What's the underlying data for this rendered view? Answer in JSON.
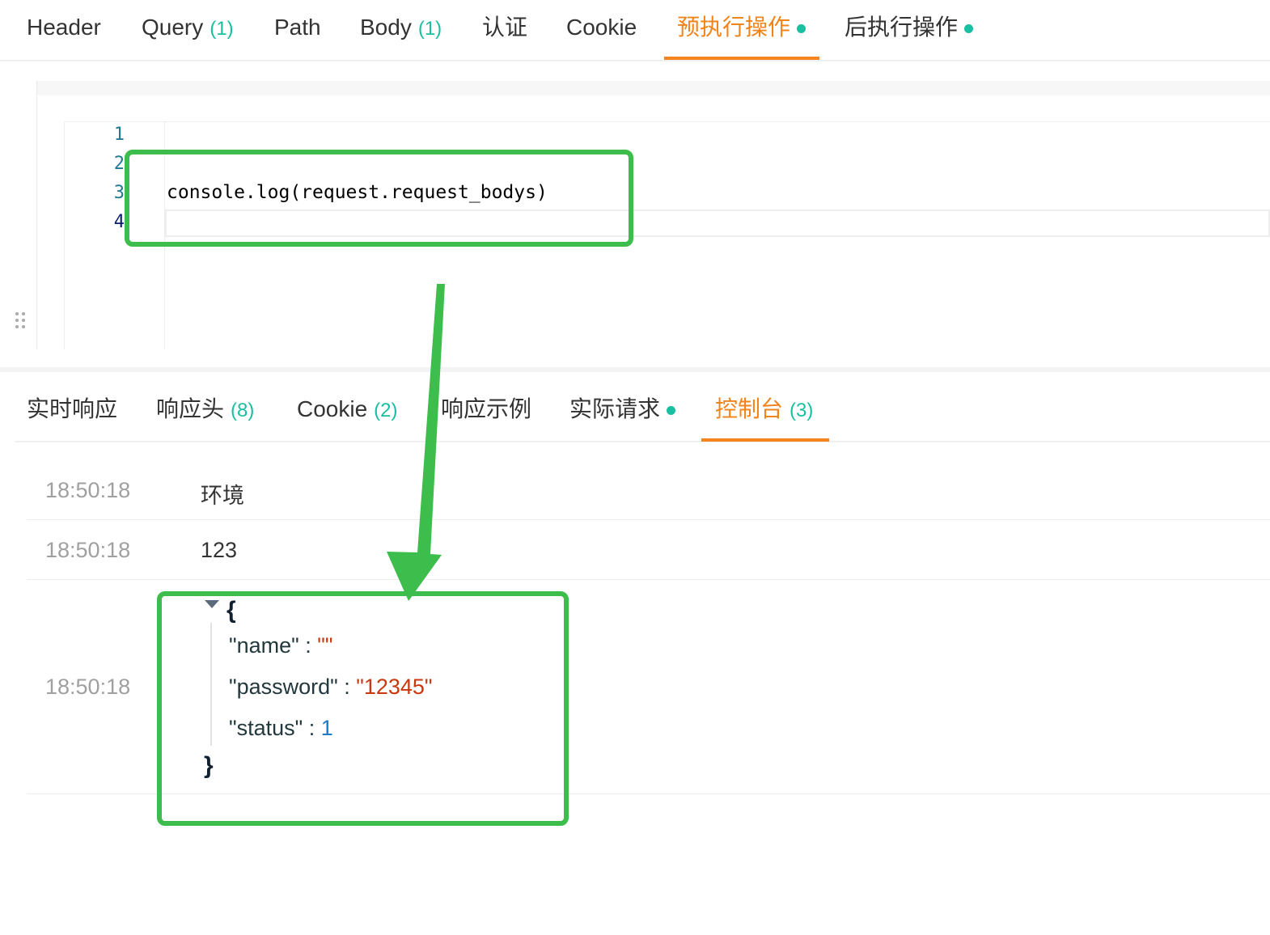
{
  "request_tabs": [
    {
      "label": "Header",
      "count": "",
      "dot": false,
      "active": false
    },
    {
      "label": "Query",
      "count": "(1)",
      "dot": false,
      "active": false
    },
    {
      "label": "Path",
      "count": "",
      "dot": false,
      "active": false
    },
    {
      "label": "Body",
      "count": "(1)",
      "dot": false,
      "active": false
    },
    {
      "label": "认证",
      "count": "",
      "dot": false,
      "active": false
    },
    {
      "label": "Cookie",
      "count": "",
      "dot": false,
      "active": false
    },
    {
      "label": "预执行操作",
      "count": "",
      "dot": true,
      "active": true
    },
    {
      "label": "后执行操作",
      "count": "",
      "dot": true,
      "active": false
    }
  ],
  "editor": {
    "line_numbers": [
      "1",
      "2",
      "3",
      "4"
    ],
    "code_line_3": "console.log(request.request_bodys)"
  },
  "response_tabs": [
    {
      "label": "实时响应",
      "count": "",
      "dot": false,
      "active": false
    },
    {
      "label": "响应头",
      "count": "(8)",
      "dot": false,
      "active": false
    },
    {
      "label": "Cookie",
      "count": "(2)",
      "dot": false,
      "active": false
    },
    {
      "label": "响应示例",
      "count": "",
      "dot": false,
      "active": false
    },
    {
      "label": "实际请求",
      "count": "",
      "dot": true,
      "active": false
    },
    {
      "label": "控制台",
      "count": "(3)",
      "dot": false,
      "active": true
    }
  ],
  "console": {
    "entries": [
      {
        "time": "18:50:18",
        "message": "环境"
      },
      {
        "time": "18:50:18",
        "message": "123"
      },
      {
        "time": "18:50:18",
        "message": ""
      }
    ],
    "json_output": {
      "open_brace": "{",
      "close_brace": "}",
      "fields": [
        {
          "key": "\"name\"",
          "sep": " : ",
          "value": "\"\"",
          "type": "string"
        },
        {
          "key": "\"password\"",
          "sep": " : ",
          "value": "\"12345\"",
          "type": "string"
        },
        {
          "key": "\"status\"",
          "sep": " : ",
          "value": "1",
          "type": "number"
        }
      ]
    }
  },
  "colors": {
    "active_tab": "#f0841a",
    "count_green": "#18bfa0",
    "annotation_green": "#3dbd4b",
    "json_string": "#c9380e",
    "json_number": "#1d7ac8"
  }
}
